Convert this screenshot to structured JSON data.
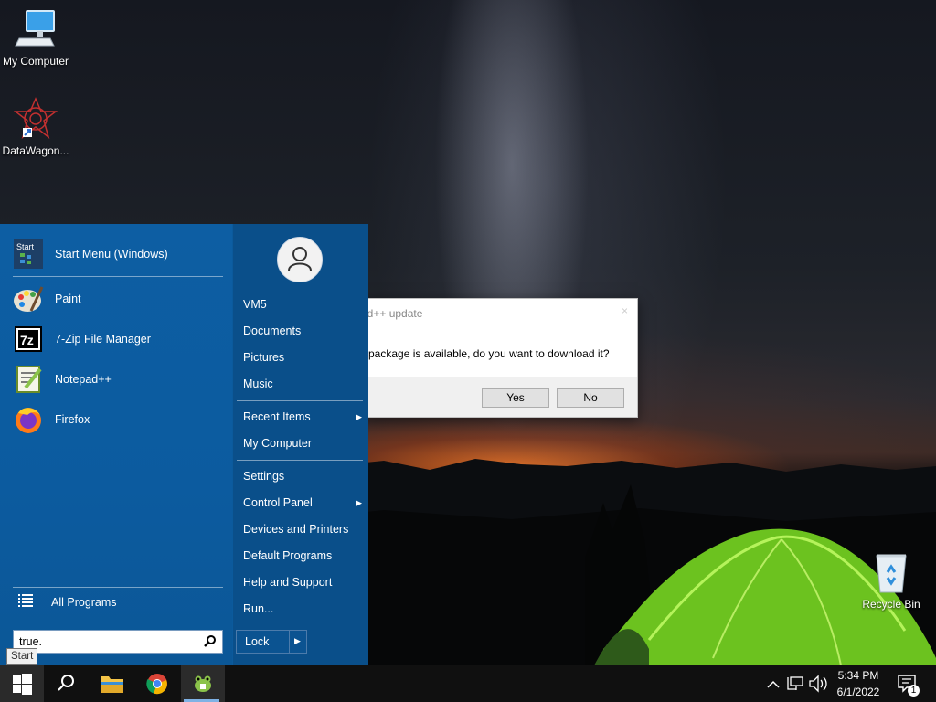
{
  "desktop": {
    "icons": [
      {
        "label": "My Computer"
      },
      {
        "label": "DataWagon..."
      },
      {
        "label": "Recycle Bin"
      }
    ]
  },
  "dialog": {
    "title": "ad++ update",
    "close": "×",
    "message": "e package is available, do you want to download it?",
    "yes_label": "Yes",
    "no_label": "No"
  },
  "start_menu": {
    "pinned": [
      {
        "label": "Start Menu (Windows)",
        "icon": "start-menu-icon"
      },
      {
        "label": "Paint",
        "icon": "paint-icon"
      },
      {
        "label": "7-Zip File Manager",
        "icon": "7zip-icon"
      },
      {
        "label": "Notepad++",
        "icon": "notepad-plus-plus-icon"
      },
      {
        "label": "Firefox",
        "icon": "firefox-icon"
      }
    ],
    "start_icon_text": "Start",
    "sevenzip_icon_text": "7z",
    "all_programs": "All Programs",
    "search_value": "true.",
    "right": {
      "user": "VM5",
      "documents": "Documents",
      "pictures": "Pictures",
      "music": "Music",
      "recent_items": "Recent Items",
      "my_computer": "My Computer",
      "settings": "Settings",
      "control_panel": "Control Panel",
      "devices_printers": "Devices and Printers",
      "default_programs": "Default Programs",
      "help_support": "Help and Support",
      "run": "Run..."
    },
    "lock_label": "Lock",
    "submenu_arrow": "▶"
  },
  "tooltip": "Start",
  "taskbar": {
    "time": "5:34 PM",
    "date": "6/1/2022",
    "notification_count": "1"
  },
  "colors": {
    "start_menu_left": "#0d5ea3",
    "start_menu_right": "#0a4f8a",
    "taskbar": "#101010",
    "tent_green": "#8fdc2c"
  }
}
